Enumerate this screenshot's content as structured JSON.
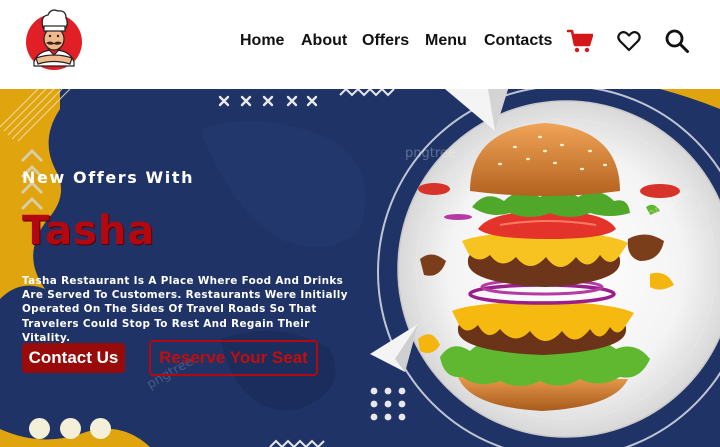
{
  "header": {
    "logo": "chef-mascot-logo",
    "nav": [
      {
        "label": "Home"
      },
      {
        "label": "About"
      },
      {
        "label": "Offers"
      },
      {
        "label": "Menu"
      },
      {
        "label": "Contacts"
      }
    ],
    "icons": [
      "shopping-cart-icon",
      "heart-icon",
      "search-icon"
    ],
    "accent_color": "#d41818"
  },
  "hero": {
    "headline": "New Offers With",
    "brand_name": "Tasha",
    "description": "Tasha Restaurant Is A Place Where Food And Drinks Are Served To Customers. Restaurants Were Initially Operated On The Sides Of Travel Roads So That Travelers Could Stop To Rest And Regain Their Vitality.",
    "primary_button": "Contact Us",
    "secondary_button": "Reserve Your Seat",
    "watermark": "pngtree",
    "slide_count": 3,
    "colors": {
      "background_yellow": "#e0a50e",
      "background_navy": "#1f3366",
      "brand_red": "#b3080f"
    }
  }
}
